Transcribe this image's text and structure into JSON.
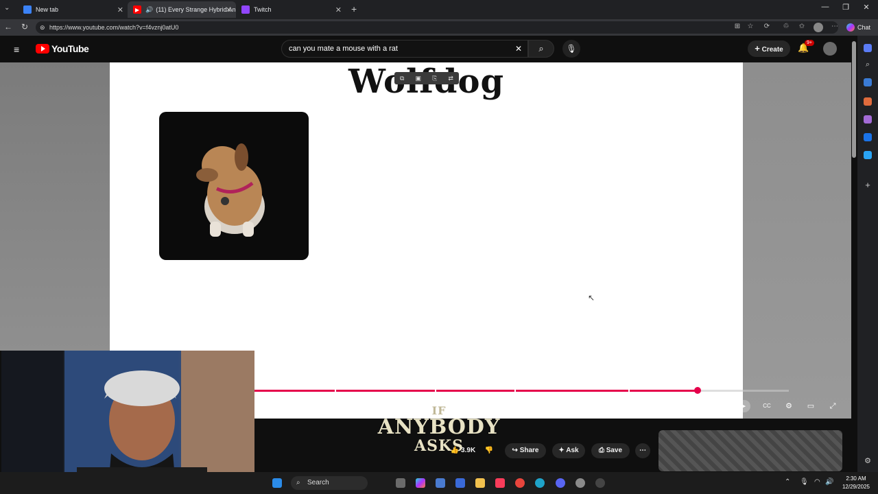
{
  "tabs": [
    {
      "label": "New tab",
      "active": false
    },
    {
      "label": "(11) Every Strange Hybrid An",
      "active": true
    },
    {
      "label": "Twitch",
      "active": false
    }
  ],
  "address": {
    "url": "https://www.youtube.com/watch?v=f4vznj0atU0"
  },
  "browser": {
    "chat_label": "Chat"
  },
  "youtube": {
    "logo_text": "YouTube",
    "search_value": "can you mate a mouse with a rat",
    "create_label": "Create",
    "notif_badge": "9+"
  },
  "video": {
    "title_text": "Wolfdog",
    "progress_fraction": 0.83
  },
  "overlay_caption": {
    "line1": "IF",
    "line2": "ANYBODY",
    "line3": "ASKS"
  },
  "actions": {
    "like_count": "3.9K",
    "share_label": "Share",
    "ask_label": "Ask",
    "save_label": "Save"
  },
  "taskbar": {
    "search_placeholder": "Search",
    "time": "2:30 AM",
    "date": "12/29/2025"
  },
  "colors": {
    "accent": "#e5004b",
    "yt_red": "#ff0000"
  }
}
